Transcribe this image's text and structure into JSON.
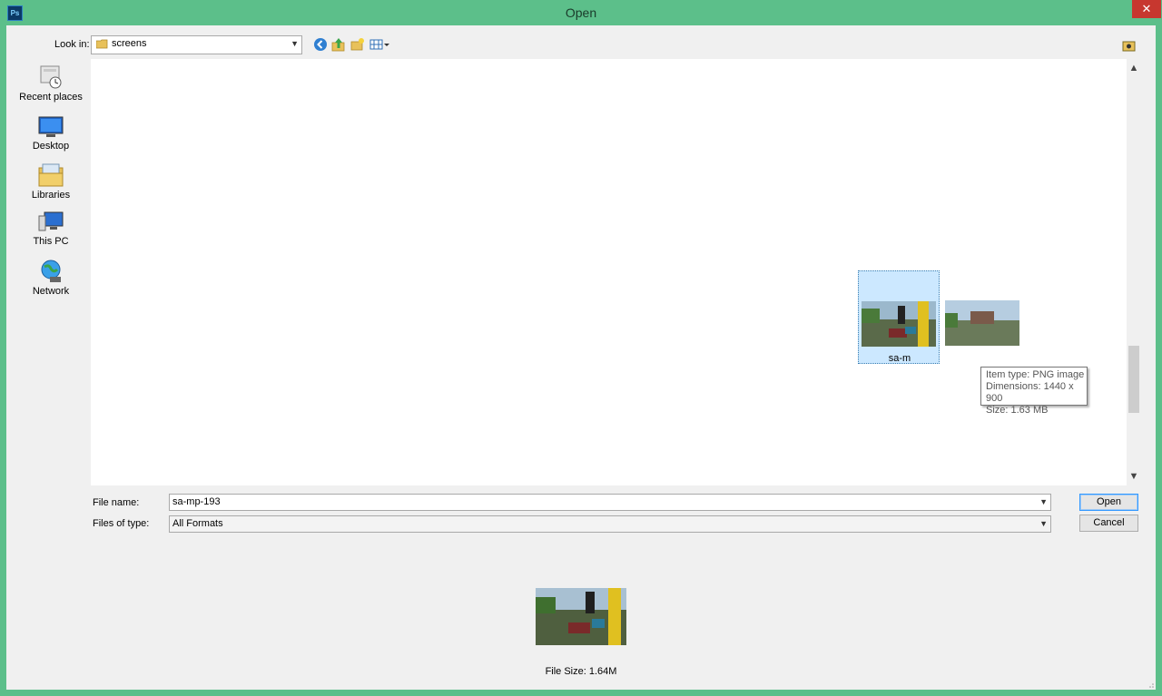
{
  "window": {
    "title": "Open",
    "app_icon_label": "Ps",
    "close_glyph": "✕",
    "accent_color": "#5cbf8a"
  },
  "lookin": {
    "label": "Look in:",
    "value": "screens",
    "icons": [
      "back-icon",
      "up-folder-icon",
      "new-folder-icon",
      "view-menu-icon"
    ]
  },
  "places": [
    {
      "label": "Recent places",
      "icon": "recent-places-icon"
    },
    {
      "label": "Desktop",
      "icon": "desktop-icon"
    },
    {
      "label": "Libraries",
      "icon": "libraries-icon"
    },
    {
      "label": "This PC",
      "icon": "this-pc-icon"
    },
    {
      "label": "Network",
      "icon": "network-icon"
    }
  ],
  "files": [
    {
      "label": "sa-m",
      "selected": true
    },
    {
      "label": "",
      "selected": false
    }
  ],
  "tooltip": {
    "line1": "Item type: PNG image",
    "line2": "Dimensions: 1440 x 900",
    "line3": "Size: 1.63 MB"
  },
  "filename": {
    "label": "File name:",
    "value": "sa-mp-193"
  },
  "filetype": {
    "label": "Files of type:",
    "value": "All Formats"
  },
  "buttons": {
    "open": "Open",
    "cancel": "Cancel"
  },
  "preview": {
    "filesize": "File Size: 1.64M"
  }
}
